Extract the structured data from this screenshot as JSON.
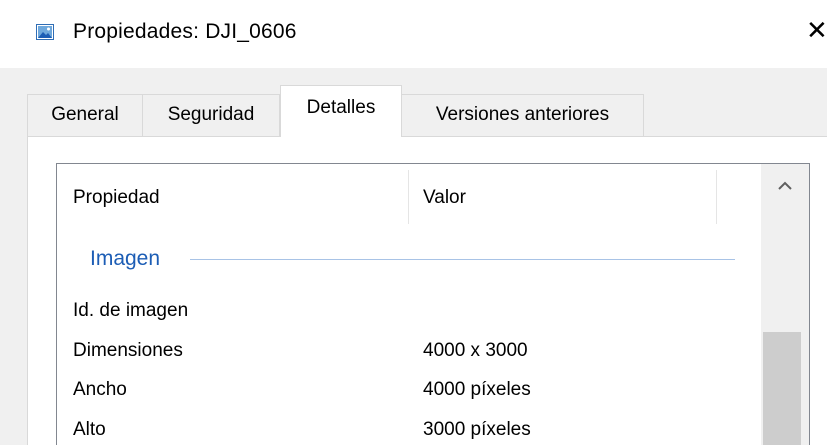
{
  "window": {
    "title": "Propiedades: DJI_0606",
    "icon": "image-file-icon",
    "close_glyph": "✕"
  },
  "tabs": [
    {
      "label": "General",
      "selected": false
    },
    {
      "label": "Seguridad",
      "selected": false
    },
    {
      "label": "Detalles",
      "selected": true
    },
    {
      "label": "Versiones anteriores",
      "selected": false
    }
  ],
  "details": {
    "columns": [
      "Propiedad",
      "Valor"
    ],
    "group": "Imagen",
    "rows": [
      {
        "property": "Id. de imagen",
        "value": ""
      },
      {
        "property": "Dimensiones",
        "value": "4000 x 3000"
      },
      {
        "property": "Ancho",
        "value": "4000 píxeles"
      },
      {
        "property": "Alto",
        "value": "3000 píxeles"
      }
    ]
  },
  "scrollbar": {
    "up_icon": "chevron-up-icon"
  },
  "colors": {
    "dialog_bg": "#f0f0f0",
    "group_label": "#1c5db5",
    "group_line": "#a8c3e6",
    "scroll_thumb": "#cdcdcd"
  }
}
